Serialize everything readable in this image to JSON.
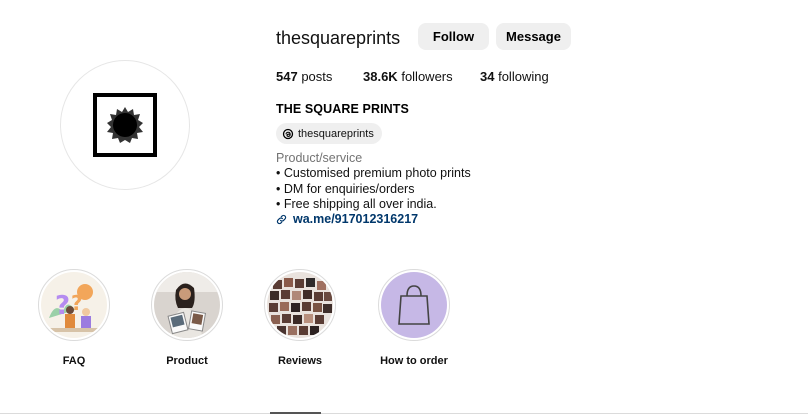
{
  "profile": {
    "username": "thesquareprints",
    "follow_label": "Follow",
    "message_label": "Message",
    "stats": {
      "posts_count": "547",
      "posts_label": "posts",
      "followers_count": "38.6K",
      "followers_label": "followers",
      "following_count": "34",
      "following_label": "following"
    },
    "full_name": "THE SQUARE PRINTS",
    "threads_handle": "thesquareprints",
    "category": "Product/service",
    "bio_lines": [
      "• Customised premium photo prints",
      "• DM for enquiries/orders",
      "• Free shipping all over india."
    ],
    "link": "wa.me/917012316217"
  },
  "highlights": [
    {
      "label": "FAQ",
      "icon": "faq-question-illustration"
    },
    {
      "label": "Product",
      "icon": "person-with-photos"
    },
    {
      "label": "Reviews",
      "icon": "photo-collage"
    },
    {
      "label": "How to order",
      "icon": "shopping-bag-icon"
    }
  ],
  "colors": {
    "link": "#00376b",
    "button_bg": "#efefef",
    "muted": "#737373"
  }
}
